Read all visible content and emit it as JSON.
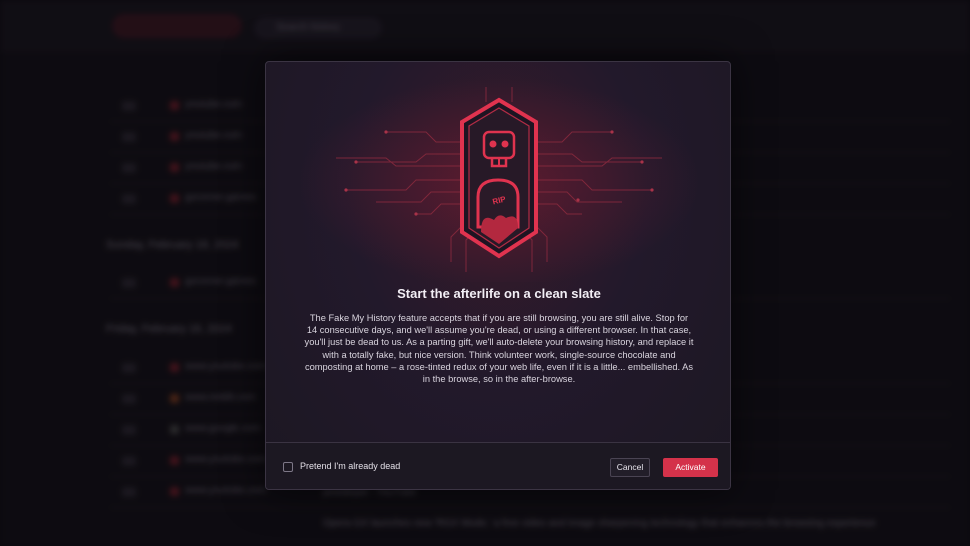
{
  "background": {
    "search_placeholder": "Search history",
    "rows_top": [
      "youtube.com",
      "youtube.com",
      "youtube.com",
      "gxcorner.games"
    ],
    "group_feb18": "Sunday, February 18, 2024",
    "row_feb18": "gxcorner.games",
    "group_feb16": "Friday, February 16, 2024",
    "rows_bottom": [
      "www.youtube.com",
      "www.reddit.com",
      "www.google.com",
      "www.youtube.com",
      "www.youtube.com"
    ],
    "bottom_text_1": "pewdiepie - YouTube",
    "bottom_text_2": "Opera GX launches new 'RGX Mode,' a free video and image sharpening technology that enhances the browsing experience"
  },
  "modal": {
    "title": "Start the afterlife on a clean slate",
    "body": "The Fake My History feature accepts that if you are still browsing, you are still alive. Stop for 14 consecutive days, and we'll assume you're dead, or using a different browser. In that case, you'll just be dead to us. As a parting gift, we'll auto-delete your browsing history, and replace it with a totally fake, but nice version. Think volunteer work, single-source chocolate and composting at home – a rose-tinted redux of your web life, even if it is a little... embellished. As in the browse, so in the after-browse.",
    "badge_text": "RIP",
    "checkbox_label": "Pretend I'm already dead",
    "cancel_label": "Cancel",
    "activate_label": "Activate"
  },
  "colors": {
    "accent": "#d4324a",
    "modal_bg": "#1c1722",
    "badge_stroke": "#e0334f"
  },
  "icons": [
    "skull-icon",
    "tombstone-icon",
    "heart-icon",
    "checkbox-icon"
  ]
}
